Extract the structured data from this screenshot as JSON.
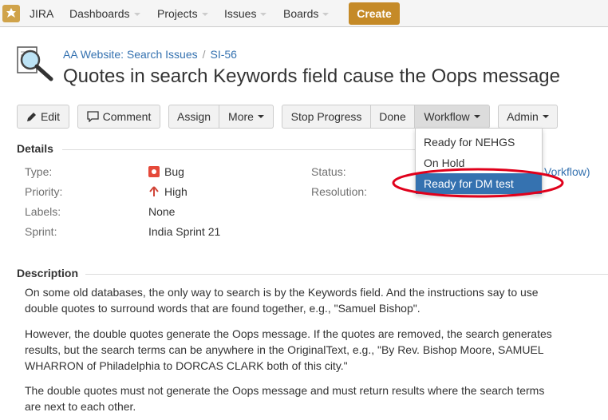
{
  "nav": {
    "app_name": "JIRA",
    "items": [
      "Dashboards",
      "Projects",
      "Issues",
      "Boards"
    ],
    "create_label": "Create"
  },
  "header": {
    "project": "AA Website: Search Issues",
    "separator": "/",
    "issue_key": "SI-56",
    "title": "Quotes in search Keywords field cause the Oops message"
  },
  "toolbar": {
    "edit": "Edit",
    "comment": "Comment",
    "assign": "Assign",
    "more": "More",
    "stop_progress": "Stop Progress",
    "done": "Done",
    "workflow": "Workflow",
    "admin": "Admin"
  },
  "workflow_menu": {
    "items": [
      "Ready for NEHGS",
      "On Hold",
      "Ready for DM test"
    ],
    "selected_index": 2
  },
  "details": {
    "heading": "Details",
    "type_label": "Type:",
    "type_value": "Bug",
    "priority_label": "Priority:",
    "priority_value": "High",
    "labels_label": "Labels:",
    "labels_value": "None",
    "sprint_label": "Sprint:",
    "sprint_value": "India Sprint 21",
    "status_label": "Status:",
    "status_link_partial": "Vorkflow)",
    "resolution_label": "Resolution:"
  },
  "description": {
    "heading": "Description",
    "p1_line1": "On some old databases, the only way to search is by the Keywords field. And the instructions say to use",
    "p1_line2": "double quotes to surround words that are found together, e.g., \"Samuel Bishop\".",
    "p2_line1": "However, the double quotes generate the Oops message. If the quotes are removed, the search generates",
    "p2_line2": "results, but the search terms can be anywhere in the OriginalText, e.g., \"By Rev. Bishop Moore, SAMUEL",
    "p2_line3": "WHARRON of Philadelphia to DORCAS CLARK both of this city.\"",
    "p3_line1": "The double quotes must not generate the Oops message and must return results where the search terms",
    "p3_line2": "are next to each other."
  },
  "colors": {
    "brand": "#c58a27",
    "link": "#3572b0",
    "selected": "#3572b0",
    "bug": "#e5493a",
    "priority_high": "#d04437",
    "annotation": "#e0001b"
  }
}
